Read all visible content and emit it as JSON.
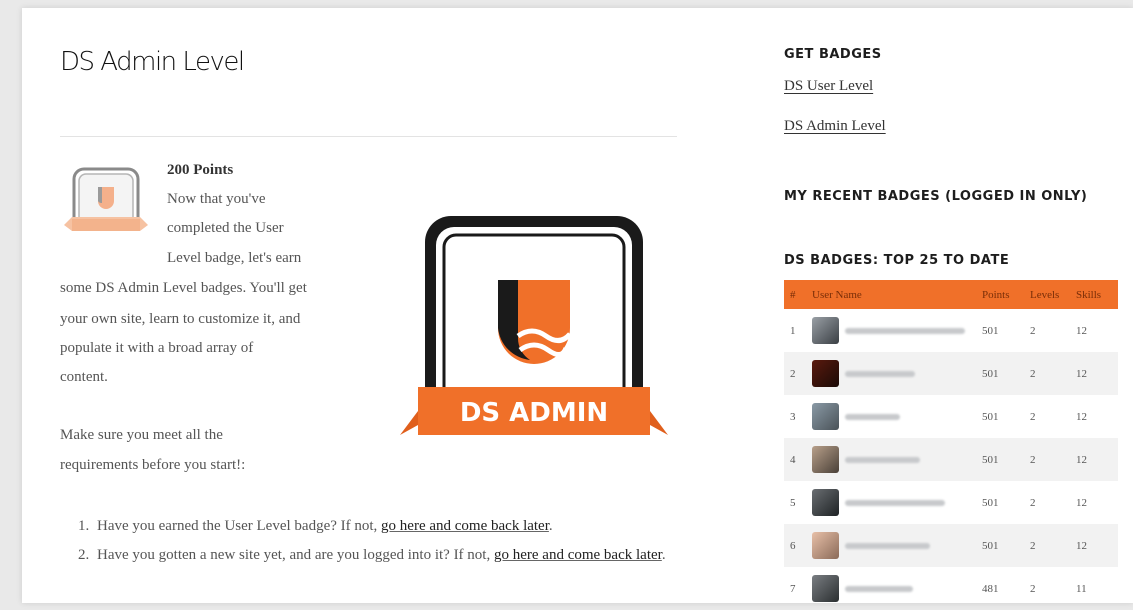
{
  "page": {
    "title": "DS Admin Level"
  },
  "content": {
    "points_label": "200 Points",
    "intro_lines": [
      "Now that you've",
      "completed the User",
      "Level badge, let's earn",
      "some DS Admin Level badges. You'll get",
      "your own site, learn to customize it, and",
      "populate it with a broad array of",
      "content."
    ],
    "requirements_lines": [
      "Make sure you meet all the",
      "requirements before you start!:"
    ],
    "badge_banner_text": "DS ADMIN",
    "requirements": [
      {
        "num": "1.",
        "text": "Have you earned the User Level badge? If not, ",
        "link": "go here and come back later",
        "after": "."
      },
      {
        "num": "2.",
        "text": "Have you gotten a new site yet, and are you logged into it? If not, ",
        "link": "go here and come back later",
        "after": "."
      }
    ]
  },
  "sidebar": {
    "get_badges_heading": "GET BADGES",
    "get_badges_links": [
      "DS User Level",
      "DS Admin Level"
    ],
    "recent_heading": "MY RECENT BADGES (LOGGED IN ONLY)",
    "top_heading": "DS BADGES: TOP 25 TO DATE",
    "table": {
      "headers": [
        "#",
        "User Name",
        "Points",
        "Levels",
        "Skills"
      ],
      "rows": [
        {
          "rank": "1",
          "points": "501",
          "levels": "2",
          "skills": "12"
        },
        {
          "rank": "2",
          "points": "501",
          "levels": "2",
          "skills": "12"
        },
        {
          "rank": "3",
          "points": "501",
          "levels": "2",
          "skills": "12"
        },
        {
          "rank": "4",
          "points": "501",
          "levels": "2",
          "skills": "12"
        },
        {
          "rank": "5",
          "points": "501",
          "levels": "2",
          "skills": "12"
        },
        {
          "rank": "6",
          "points": "501",
          "levels": "2",
          "skills": "12"
        },
        {
          "rank": "7",
          "points": "481",
          "levels": "2",
          "skills": "11"
        }
      ]
    }
  },
  "colors": {
    "accent": "#f07029",
    "badge_dark": "#1a1a1a"
  }
}
